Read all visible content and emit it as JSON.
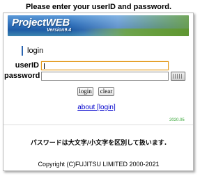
{
  "header": {
    "instruction": "Please enter your userID and password."
  },
  "banner": {
    "brand": "ProjectWEB",
    "version": "Version9.4"
  },
  "login_form": {
    "section_title": "login",
    "userid_label": "userID",
    "userid_value": "",
    "password_label": "password",
    "password_value": "",
    "login_button": "login",
    "clear_button": "clear",
    "about_link": "about [login]",
    "release_date": "2020.05"
  },
  "footer": {
    "notice": "パスワードは大文字/小文字を区別して扱います.",
    "copyright": "Copyright (C)FUJITSU LIMITED 2000-2021"
  },
  "colors": {
    "link": "#0000cc",
    "focus_border": "#e39a1c",
    "date_text": "#2aa02a",
    "title_bar_accent": "#2a64b0"
  },
  "icons": {
    "keyboard": "software-keyboard-icon"
  }
}
